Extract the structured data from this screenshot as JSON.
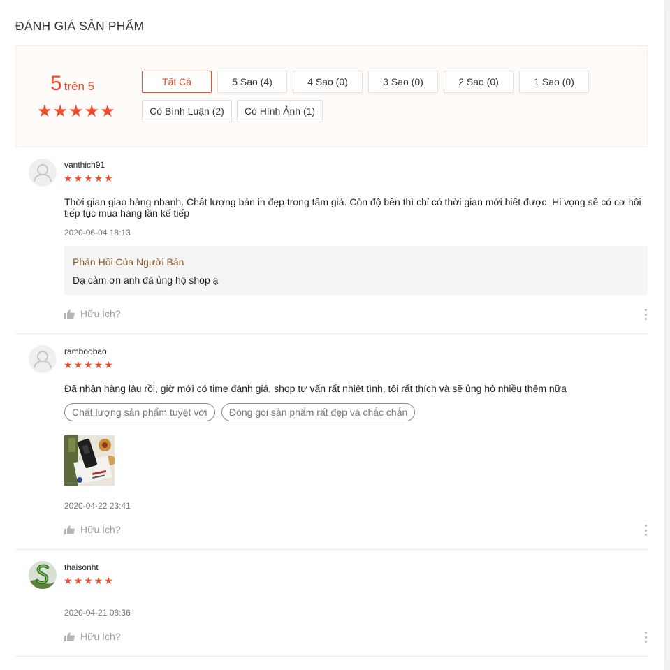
{
  "section_title": "ĐÁNH GIÁ SẢN PHẨM",
  "overview": {
    "score": "5",
    "score_suffix": "trên 5",
    "rating_stars": 5,
    "filters": [
      {
        "label": "Tất Cả",
        "active": true
      },
      {
        "label": "5 Sao (4)",
        "active": false
      },
      {
        "label": "4 Sao (0)",
        "active": false
      },
      {
        "label": "3 Sao (0)",
        "active": false
      },
      {
        "label": "2 Sao (0)",
        "active": false
      },
      {
        "label": "1 Sao (0)",
        "active": false
      },
      {
        "label": "Có Bình Luận (2)",
        "active": false
      },
      {
        "label": "Có Hình Ảnh (1)",
        "active": false
      }
    ]
  },
  "colors": {
    "accent": "#ee4d2d",
    "overview_bg": "#fffbf8",
    "reply_title": "#8b5f2b"
  },
  "reviews": [
    {
      "username": "vanthich91",
      "stars": 5,
      "avatar": "default-user-avatar",
      "comment": "Thời gian giao hàng nhanh. Chất lượng bản in đẹp trong tầm giá. Còn độ bền thì chỉ có thời gian mới biết được. Hi vọng sẽ có cơ hội tiếp tục mua hàng lần kế tiếp",
      "timestamp": "2020-06-04 18:13",
      "reply": {
        "title": "Phản Hồi Của Người Bán",
        "text": "Dạ cảm ơn anh đã ủng hộ shop ạ"
      },
      "helpful_label": "Hữu Ích?"
    },
    {
      "username": "ramboobao",
      "stars": 5,
      "avatar": "default-user-avatar",
      "comment": "Đã nhận hàng lâu rồi, giờ mới có time đánh giá, shop tư vấn rất nhiệt tình, tôi rất thích và sẽ ủng hộ nhiều thêm nữa",
      "tags": [
        "Chất lượng sản phẩm tuyệt vời",
        "Đóng gói sản phẩm rất đẹp và chắc chắn"
      ],
      "photo": "product-photo",
      "timestamp": "2020-04-22 23:41",
      "helpful_label": "Hữu Ích?"
    },
    {
      "username": "thaisonht",
      "stars": 5,
      "avatar": "s-letter-avatar",
      "timestamp": "2020-04-21 08:36",
      "helpful_label": "Hữu Ích?"
    }
  ]
}
